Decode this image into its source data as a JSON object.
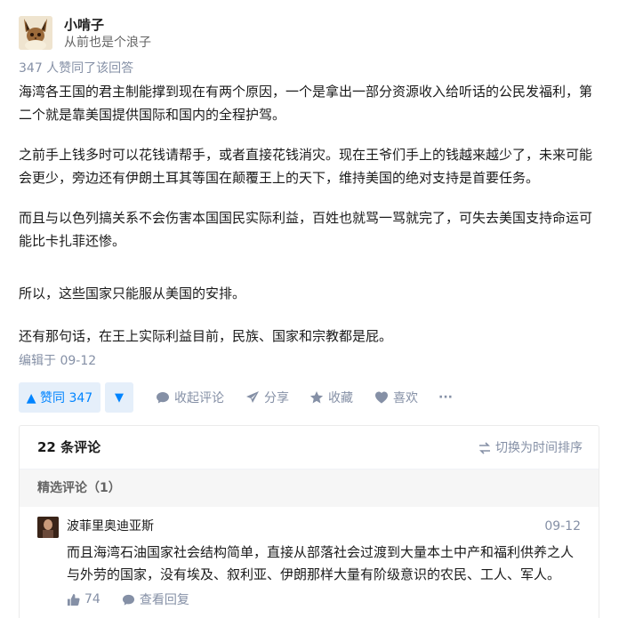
{
  "author": {
    "name": "小啃子",
    "bio": "从前也是个浪子",
    "avatar_icon": "eevee-avatar"
  },
  "votes_summary": "347 人赞同了该回答",
  "content": [
    "海湾各王国的君主制能撑到现在有两个原因，一个是拿出一部分资源收入给听话的公民发福利，第二个就是靠美国提供国际和国内的全程护驾。",
    "之前手上钱多时可以花钱请帮手，或者直接花钱消灾。现在王爷们手上的钱越来越少了，未来可能会更少，旁边还有伊朗土耳其等国在颠覆王上的天下，维持美国的绝对支持是首要任务。",
    "而且与以色列搞关系不会伤害本国国民实际利益，百姓也就骂一骂就完了，可失去美国支持命运可能比卡扎菲还惨。",
    "所以，这些国家只能服从美国的安排。",
    "还有那句话，在王上实际利益目前，民族、国家和宗教都是屁。"
  ],
  "edited": "编辑于 09-12",
  "actions": {
    "upvote_label": "▲ 赞同 347",
    "downvote_icon": "triangle-down-icon",
    "collapse_comments": "收起评论",
    "share": "分享",
    "favorite": "收藏",
    "like": "喜欢",
    "more": "···"
  },
  "comments": {
    "count_label": "22 条评论",
    "sort_label": "切换为时间排序",
    "featured_label": "精选评论（1）",
    "items": [
      {
        "author": "波菲里奥迪亚斯",
        "time": "09-12",
        "text": "而且海湾石油国家社会结构简单，直接从部落社会过渡到大量本土中产和福利供养之人与外劳的国家，没有埃及、叙利亚、伊朗那样大量有阶级意识的农民、工人、军人。",
        "likes": "74",
        "reply_label": "查看回复"
      }
    ]
  },
  "colors": {
    "accent": "#0084ff",
    "accent_bg": "#e5effa",
    "muted": "#8590a6"
  }
}
